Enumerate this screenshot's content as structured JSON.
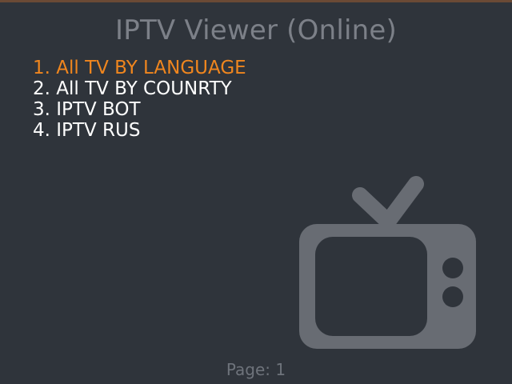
{
  "app": {
    "title": "IPTV Viewer (Online)"
  },
  "menu": {
    "items": [
      {
        "label": "1. All TV BY LANGUAGE",
        "selected": true
      },
      {
        "label": "2. All TV BY COUNRTY",
        "selected": false
      },
      {
        "label": "3. IPTV BOT",
        "selected": false
      },
      {
        "label": "4. IPTV RUS",
        "selected": false
      }
    ]
  },
  "footer": {
    "page_label": "Page: 1"
  },
  "graphic": {
    "icon": "television-icon"
  },
  "colors": {
    "background": "#2f343b",
    "selected": "#f0861e",
    "text": "#ffffff",
    "muted": "#7c8088",
    "tv": "#686c73"
  }
}
